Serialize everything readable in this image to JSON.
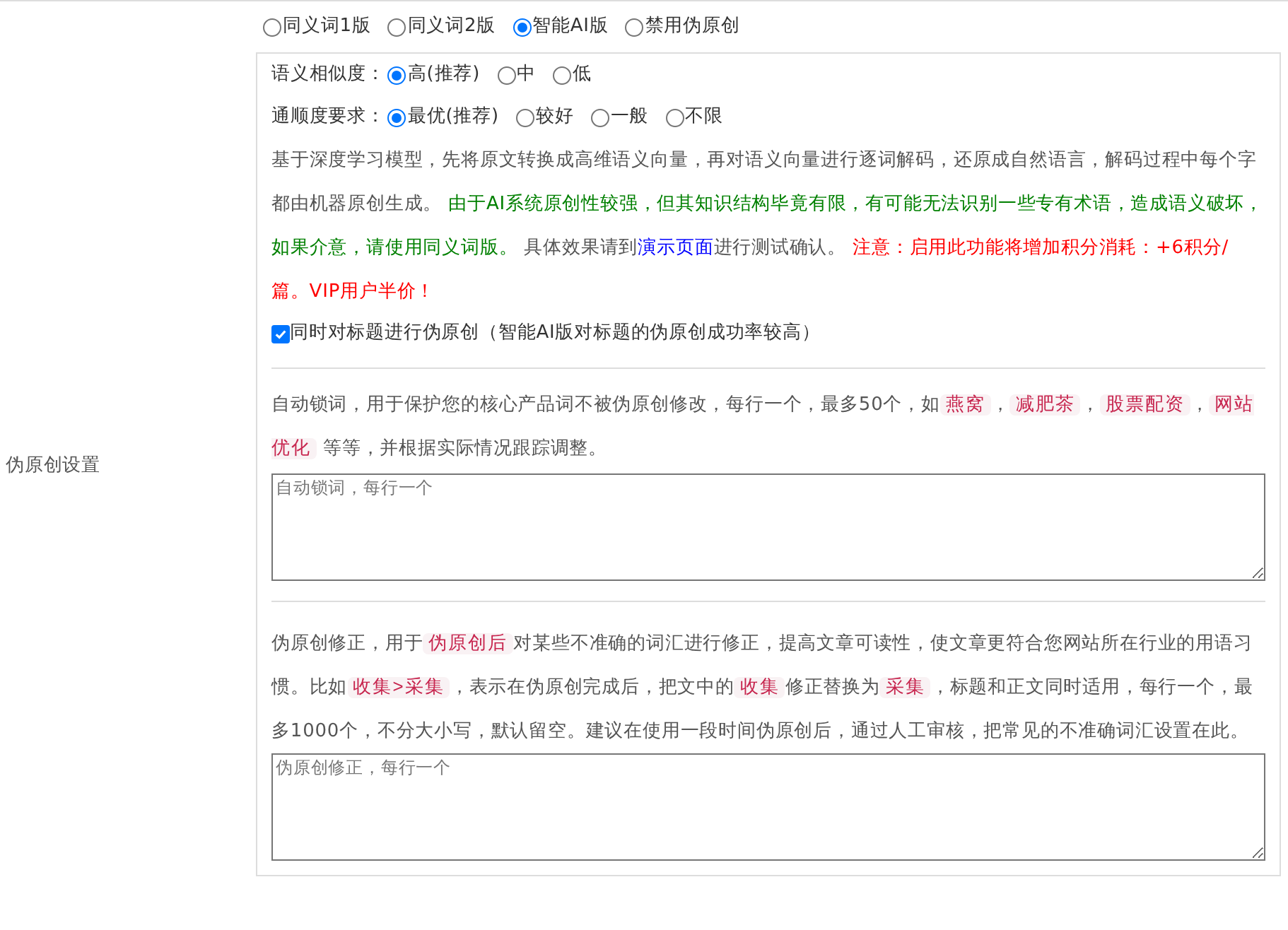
{
  "side_label": "伪原创设置",
  "modes": [
    {
      "label": "同义词1版",
      "selected": false
    },
    {
      "label": "同义词2版",
      "selected": false
    },
    {
      "label": "智能AI版",
      "selected": true
    },
    {
      "label": "禁用伪原创",
      "selected": false
    }
  ],
  "option_groups": [
    {
      "label": "语义相似度：",
      "options": [
        {
          "label": "高(推荐)",
          "selected": true
        },
        {
          "label": "中",
          "selected": false
        },
        {
          "label": "低",
          "selected": false
        }
      ]
    },
    {
      "label": "通顺度要求：",
      "options": [
        {
          "label": "最优(推荐)",
          "selected": true
        },
        {
          "label": "较好",
          "selected": false
        },
        {
          "label": "一般",
          "selected": false
        },
        {
          "label": "不限",
          "selected": false
        }
      ]
    }
  ],
  "ai_description": [
    {
      "kind": "plain",
      "text": "基于深度学习模型，先将原文转换成高维语义向量，再对语义向量进行逐词解码，还原成自然语言，解码过程中每个字都由机器原创生成。 "
    },
    {
      "kind": "green",
      "text": "由于AI系统原创性较强，但其知识结构毕竟有限，有可能无法识别一些专有术语，造成语义破坏，如果介意，请使用同义词版。"
    },
    {
      "kind": "plain",
      "text": " 具体效果请到"
    },
    {
      "kind": "link",
      "text": "演示页面"
    },
    {
      "kind": "plain",
      "text": "进行测试确认。 "
    },
    {
      "kind": "red",
      "text": "注意：启用此功能将增加积分消耗：+6积分/篇。VIP用户半价！"
    }
  ],
  "title_option": {
    "label": "同时对标题进行伪原创（智能AI版对标题的伪原创成功率较高）",
    "checked": true
  },
  "lock_section": {
    "description": [
      {
        "kind": "plain",
        "text": "自动锁词，用于保护您的核心产品词不被伪原创修改，每行一个，最多50个，如"
      },
      {
        "kind": "code",
        "text": "燕窝"
      },
      {
        "kind": "plain",
        "text": "，"
      },
      {
        "kind": "code",
        "text": "减肥茶"
      },
      {
        "kind": "plain",
        "text": "，"
      },
      {
        "kind": "code",
        "text": "股票配资"
      },
      {
        "kind": "plain",
        "text": "，"
      },
      {
        "kind": "code",
        "text": "网站优化"
      },
      {
        "kind": "plain",
        "text": " 等等，并根据实际情况跟踪调整。"
      }
    ],
    "placeholder": "自动锁词，每行一个"
  },
  "correction_section": {
    "description": [
      {
        "kind": "plain",
        "text": "伪原创修正，用于"
      },
      {
        "kind": "code",
        "text": "伪原创后"
      },
      {
        "kind": "plain",
        "text": "对某些不准确的词汇进行修正，提高文章可读性，使文章更符合您网站所在行业的用语习惯。比如"
      },
      {
        "kind": "code",
        "text": "收集>采集"
      },
      {
        "kind": "plain",
        "text": "，表示在伪原创完成后，把文中的"
      },
      {
        "kind": "code",
        "text": "收集"
      },
      {
        "kind": "plain",
        "text": "修正替换为"
      },
      {
        "kind": "code",
        "text": "采集"
      },
      {
        "kind": "plain",
        "text": "，标题和正文同时适用，每行一个，最多1000个，不分大小写，默认留空。建议在使用一段时间伪原创后，通过人工审核，把常见的不准确词汇设置在此。"
      }
    ],
    "placeholder": "伪原创修正，每行一个"
  }
}
